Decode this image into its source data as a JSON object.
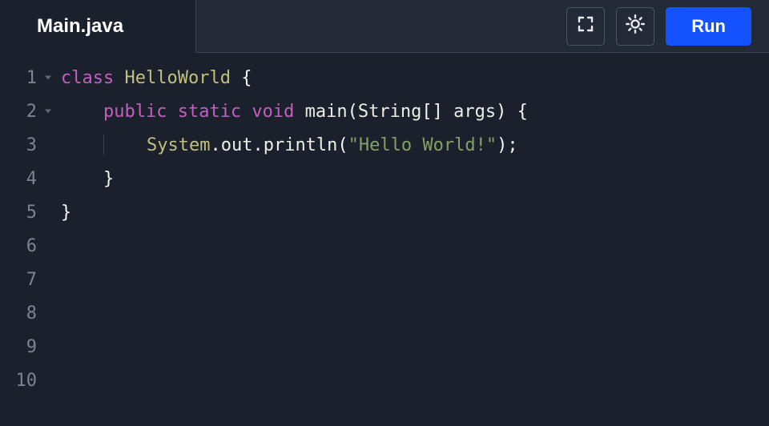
{
  "tab": {
    "title": "Main.java"
  },
  "toolbar": {
    "run_label": "Run"
  },
  "gutter": {
    "lines": [
      "1",
      "2",
      "3",
      "4",
      "5",
      "6",
      "7",
      "8",
      "9",
      "10"
    ],
    "fold_lines": [
      0,
      1
    ]
  },
  "code": {
    "lines": [
      {
        "indent": 0,
        "tokens": [
          {
            "t": "class ",
            "c": "tk-kw"
          },
          {
            "t": "HelloWorld ",
            "c": "tk-id"
          },
          {
            "t": "{",
            "c": "tk-p"
          }
        ]
      },
      {
        "indent": 1,
        "tokens": [
          {
            "t": "public ",
            "c": "tk-kw"
          },
          {
            "t": "static ",
            "c": "tk-kw"
          },
          {
            "t": "void ",
            "c": "tk-type"
          },
          {
            "t": "main",
            "c": "tk-fn"
          },
          {
            "t": "(",
            "c": "tk-p"
          },
          {
            "t": "String",
            "c": "tk-fn"
          },
          {
            "t": "[] ",
            "c": "tk-p"
          },
          {
            "t": "args",
            "c": "tk-fn"
          },
          {
            "t": ") {",
            "c": "tk-p"
          }
        ]
      },
      {
        "indent": 2,
        "tokens": [
          {
            "t": "System",
            "c": "tk-id"
          },
          {
            "t": ".",
            "c": "tk-p"
          },
          {
            "t": "out",
            "c": "tk-fn"
          },
          {
            "t": ".",
            "c": "tk-p"
          },
          {
            "t": "println",
            "c": "tk-fn"
          },
          {
            "t": "(",
            "c": "tk-p"
          },
          {
            "t": "\"Hello World!\"",
            "c": "tk-str"
          },
          {
            "t": ");",
            "c": "tk-p"
          }
        ]
      },
      {
        "indent": 1,
        "tokens": [
          {
            "t": "}",
            "c": "tk-p"
          }
        ]
      },
      {
        "indent": 0,
        "tokens": [
          {
            "t": "}",
            "c": "tk-p"
          }
        ]
      },
      {
        "indent": 0,
        "tokens": []
      },
      {
        "indent": 0,
        "tokens": []
      },
      {
        "indent": 0,
        "tokens": []
      },
      {
        "indent": 0,
        "tokens": []
      },
      {
        "indent": 0,
        "tokens": []
      }
    ]
  }
}
